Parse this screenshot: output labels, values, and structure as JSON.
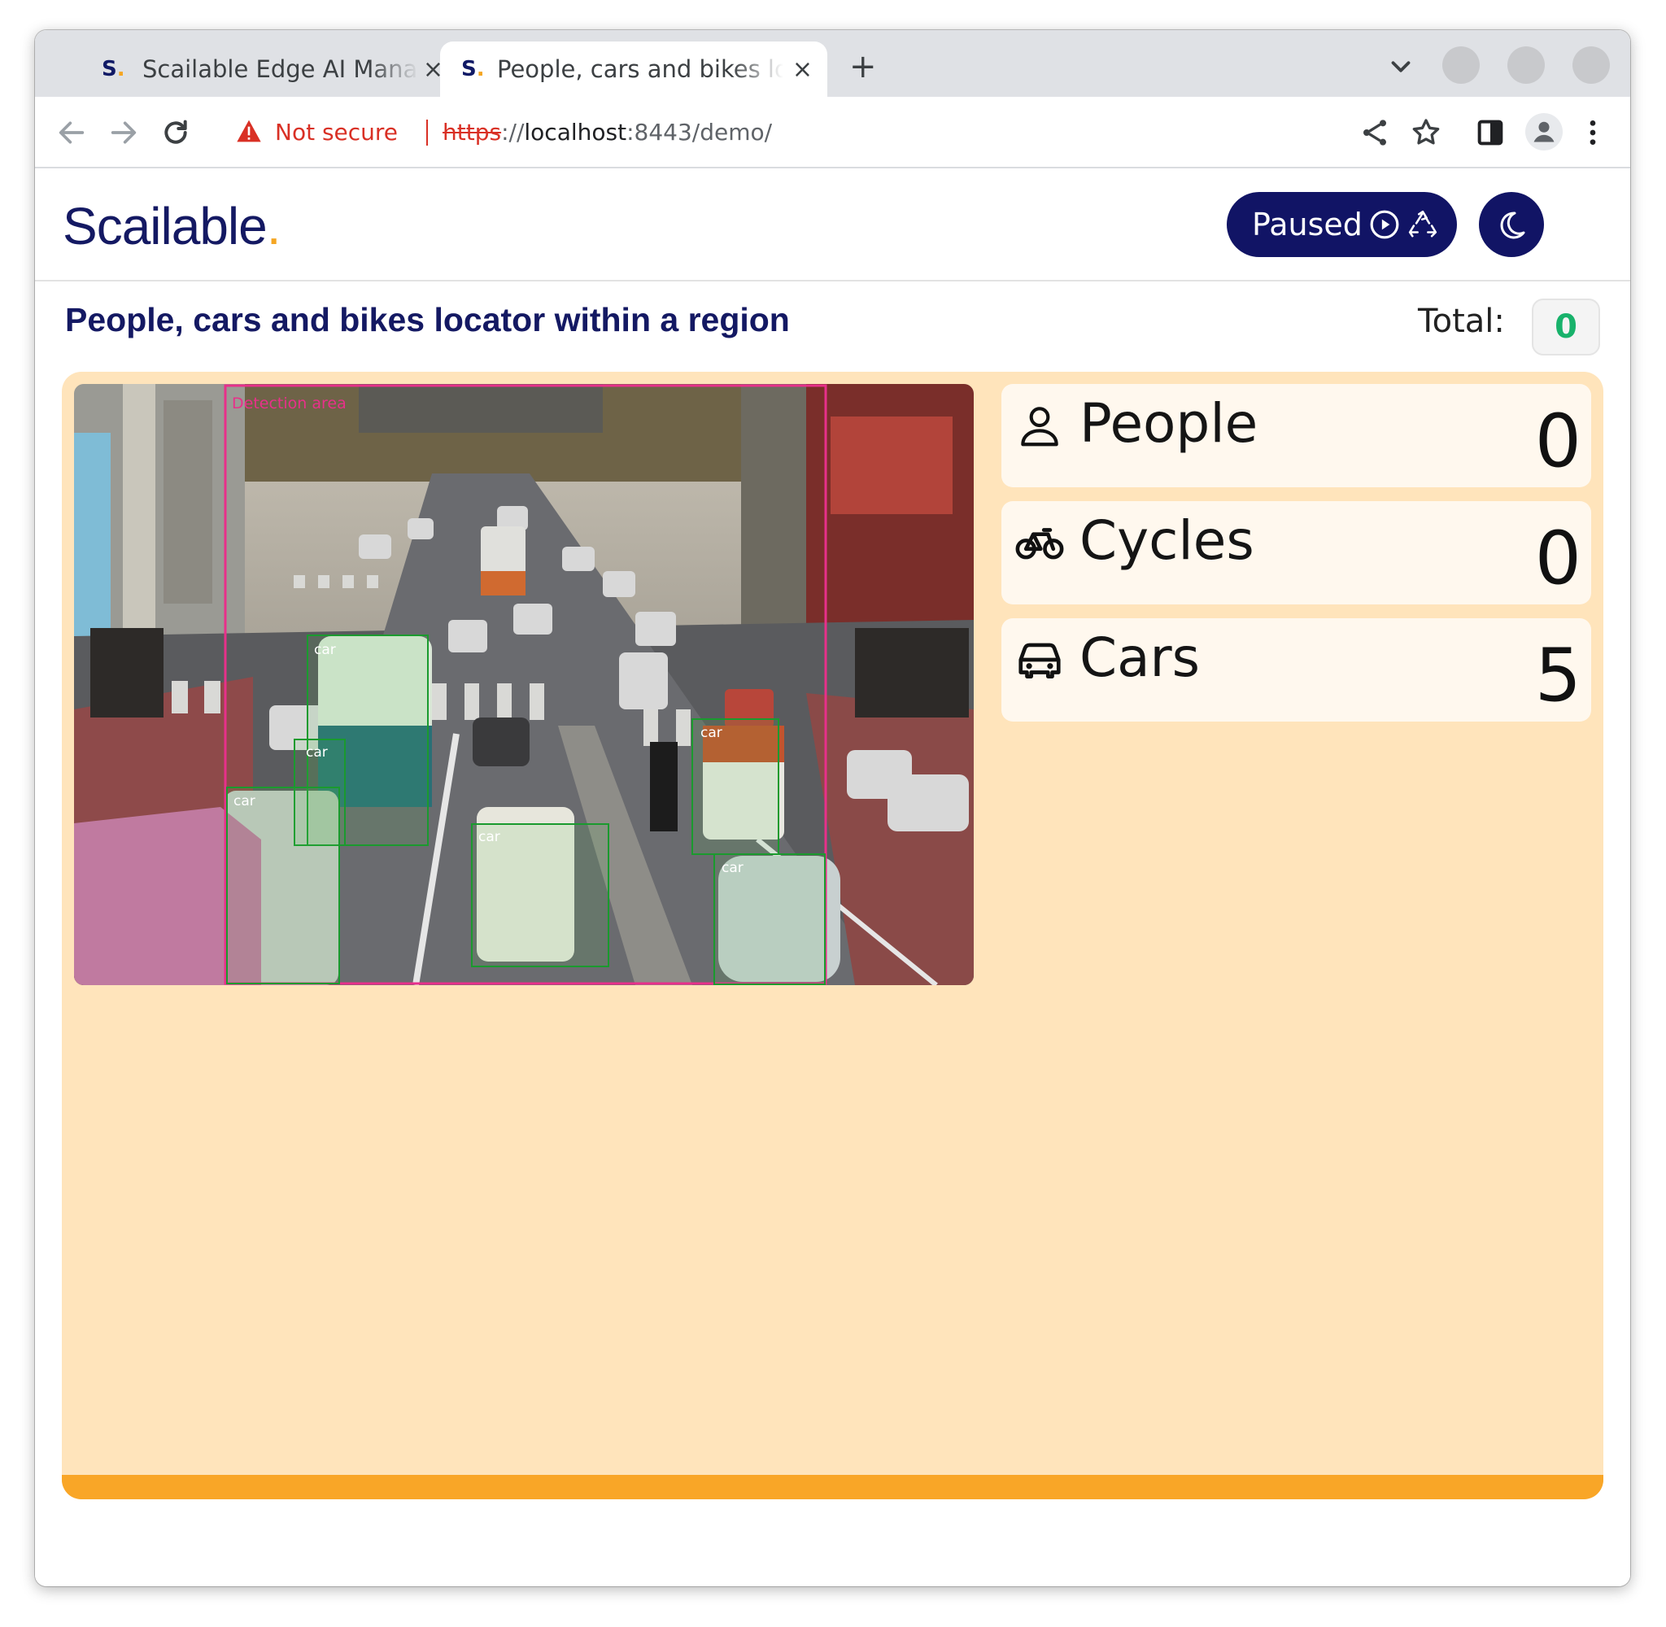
{
  "browser": {
    "tabs": [
      {
        "favicon": "S",
        "title": "Scailable Edge AI Manager",
        "close": "×",
        "active": false
      },
      {
        "favicon": "S",
        "title": "People, cars and bikes locator within a region",
        "close": "×",
        "active": true
      }
    ],
    "new_tab": "+",
    "security_label": "Not secure",
    "url": {
      "scheme": "https",
      "separator": "://",
      "host": "localhost",
      "rest": ":8443/demo/"
    }
  },
  "app": {
    "brand": "Scailable",
    "brand_dot": ".",
    "status_button": "Paused",
    "theme_icon": "moon-icon",
    "accent": "#f5a623",
    "navy": "#111465"
  },
  "page": {
    "title": "People, cars and bikes locator within a region",
    "total_label": "Total:",
    "total_value": "0"
  },
  "detection": {
    "region_label": "Detection area",
    "box_label": "car",
    "region_color": "#e8308a",
    "box_color": "#1a9a2e"
  },
  "counters": [
    {
      "label": "People",
      "value": "0",
      "icon": "person-icon"
    },
    {
      "label": "Cycles",
      "value": "0",
      "icon": "bicycle-icon"
    },
    {
      "label": "Cars",
      "value": "5",
      "icon": "car-icon"
    }
  ]
}
